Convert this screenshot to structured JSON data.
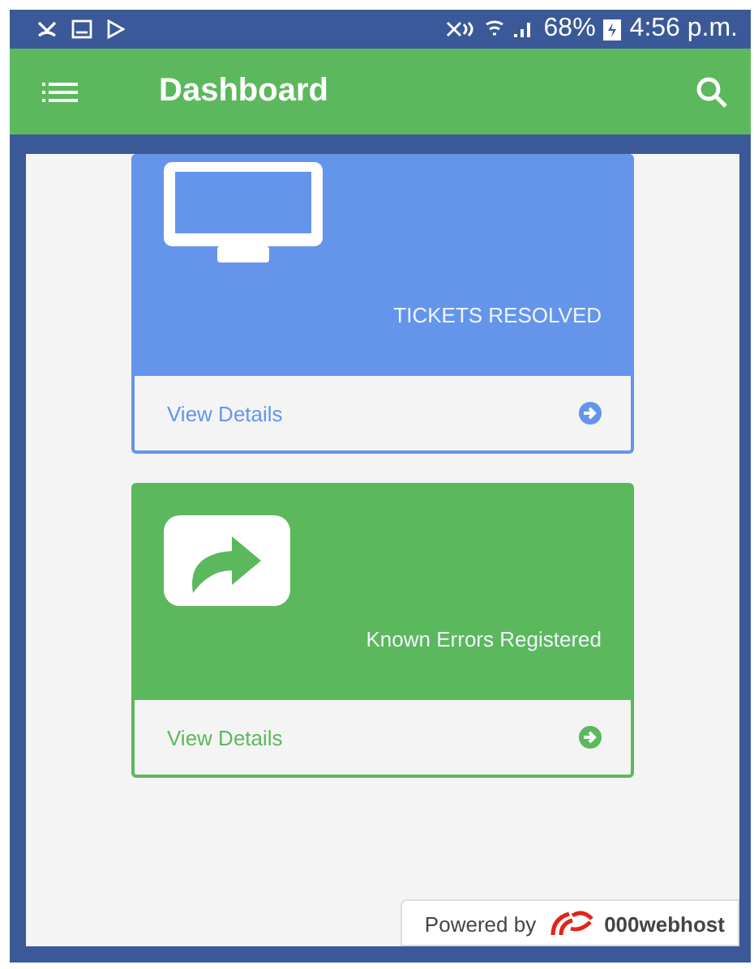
{
  "status_bar": {
    "battery": "68%",
    "time": "4:56 p.m."
  },
  "app_bar": {
    "title": "Dashboard"
  },
  "cards": [
    {
      "kind": "monitor",
      "label": "TICKETS RESOLVED",
      "link": "View Details",
      "color": "#6495ea"
    },
    {
      "kind": "share",
      "label": "Known Errors Registered",
      "link": "View Details",
      "color": "#5cb85c"
    }
  ],
  "footer": {
    "prefix": "Powered by",
    "brand": "000webhost"
  }
}
